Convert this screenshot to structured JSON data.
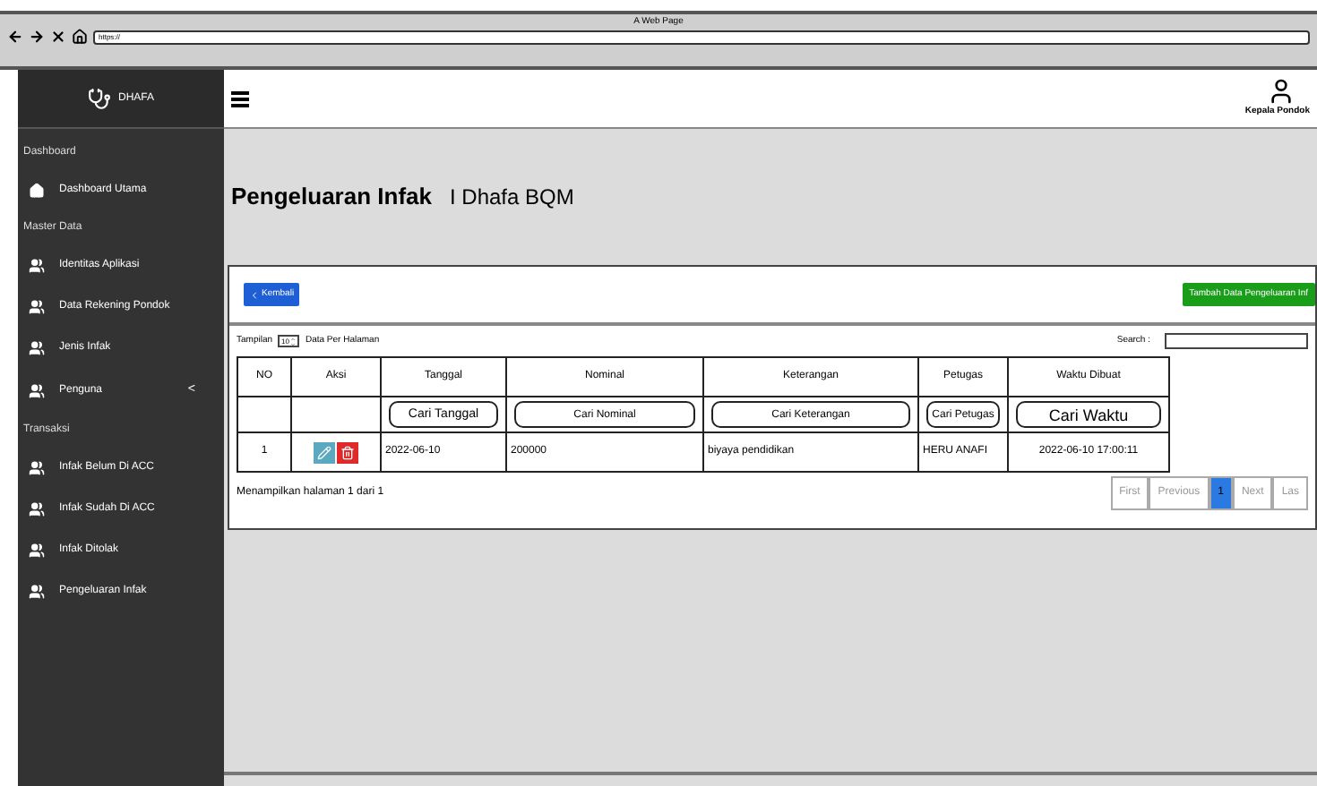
{
  "browser": {
    "title": "A Web Page",
    "url": "https://"
  },
  "brand": {
    "name": "DHAFA"
  },
  "user": {
    "name": "Kepala Pondok"
  },
  "sidebar": {
    "items": [
      {
        "kind": "section",
        "label": "Dashboard"
      },
      {
        "kind": "home",
        "label": "Dashboard Utama"
      },
      {
        "kind": "section",
        "label": "Master Data"
      },
      {
        "kind": "item",
        "label": "Identitas Aplikasi"
      },
      {
        "kind": "item",
        "label": "Data Rekening Pondok"
      },
      {
        "kind": "item",
        "label": "Jenis Infak"
      },
      {
        "kind": "item",
        "label": "Penguna",
        "chevron": "<"
      },
      {
        "kind": "section",
        "label": "Transaksi"
      },
      {
        "kind": "item",
        "label": "Infak Belum Di ACC"
      },
      {
        "kind": "item",
        "label": "Infak Sudah Di ACC"
      },
      {
        "kind": "item",
        "label": "Infak Ditolak"
      },
      {
        "kind": "item",
        "label": "Pengeluaran Infak"
      }
    ]
  },
  "page": {
    "title": "Pengeluaran Infak",
    "subtitle": "I Dhafa BQM"
  },
  "back_button": "Kembali",
  "add_button": "Tambah Data Pengeluaran Inf",
  "per_page": {
    "before": "Tampilan",
    "value": "10",
    "after": "Data Per Halaman"
  },
  "search": {
    "label": "Search :"
  },
  "table": {
    "columns": [
      "NO",
      "Aksi",
      "Tanggal",
      "Nominal",
      "Keterangan",
      "Petugas",
      "Waktu Dibuat"
    ],
    "filters": [
      "Cari Tanggal",
      "Cari Nominal",
      "Cari Keterangan",
      "Cari Petugas",
      "Cari Waktu"
    ],
    "rows": [
      [
        "1",
        "",
        "2022-06-10",
        "200000",
        "biyaya pendidikan",
        "HERU ANAFI",
        "2022-06-10 17:00:11"
      ]
    ]
  },
  "footer_info": "Menampilkan halaman 1 dari 1",
  "pagination": [
    {
      "label": "First",
      "selected": false
    },
    {
      "label": "Previous",
      "selected": false
    },
    {
      "label": "1",
      "selected": true
    },
    {
      "label": "Next",
      "selected": false
    },
    {
      "label": "Las",
      "selected": false
    }
  ]
}
